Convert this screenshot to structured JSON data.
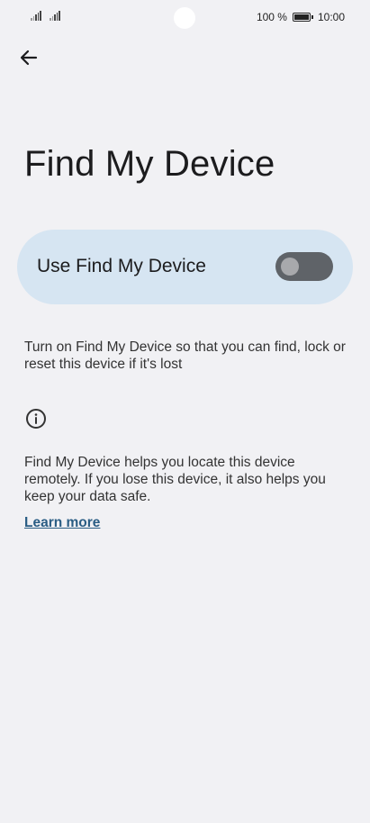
{
  "status_bar": {
    "battery_percent": "100 %",
    "time": "10:00"
  },
  "icons": {
    "back": "arrow-left-icon",
    "info": "info-icon",
    "signal": "signal-icon",
    "battery": "battery-icon"
  },
  "page": {
    "title": "Find My Device",
    "toggle": {
      "label": "Use Find My Device",
      "enabled": false
    },
    "description": "Turn on Find My Device so that you can find, lock or reset this device if it's lost",
    "info_text": "Find My Device helps you locate this device remotely. If you lose this device, it also helps you keep your data safe.",
    "learn_more": "Learn more"
  },
  "colors": {
    "background": "#f1f1f4",
    "card": "#d6e5f2",
    "switch_track": "#5f6368",
    "link": "#2a5d84"
  }
}
